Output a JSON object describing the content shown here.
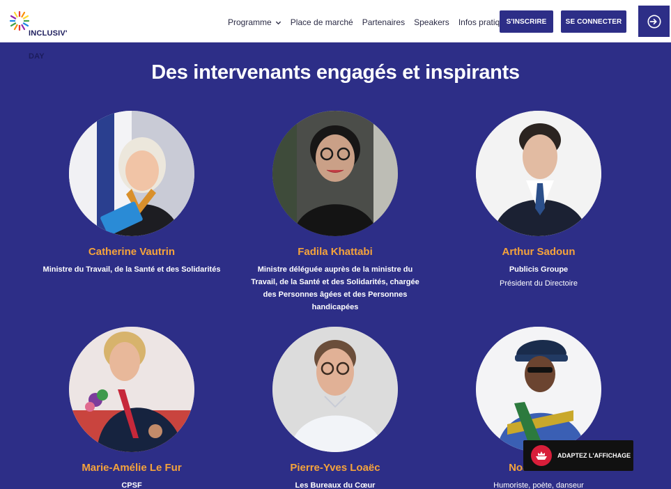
{
  "header": {
    "logo": {
      "line1": "INCLUSIV'",
      "line2": "DAY"
    },
    "nav": [
      {
        "label": "Programme",
        "dropdown": true
      },
      {
        "label": "Place de marché"
      },
      {
        "label": "Partenaires"
      },
      {
        "label": "Speakers"
      },
      {
        "label": "Infos pratiques"
      }
    ],
    "register_label": "S'INSCRIRE",
    "login_label": "SE CONNECTER",
    "exit_icon": "sign-in-icon"
  },
  "section": {
    "title": "Des intervenants engagés et inspirants"
  },
  "speakers": [
    {
      "name": "Catherine Vautrin",
      "org": "Ministre du Travail, de la Santé et des Solidarités",
      "role": ""
    },
    {
      "name": "Fadila Khattabi",
      "org": "Ministre déléguée auprès de la ministre du Travail, de la Santé et des Solidarités, chargée des Personnes âgées et des Personnes handicapées",
      "role": ""
    },
    {
      "name": "Arthur Sadoun",
      "org": "Publicis Groupe",
      "role": "Président du Directoire"
    },
    {
      "name": "Marie-Amélie Le Fur",
      "org": "CPSF",
      "role": ""
    },
    {
      "name": "Pierre-Yves Loaëc",
      "org": "Les Bureaux du Cœur",
      "role": ""
    },
    {
      "name": "Noam Cissé",
      "org": "",
      "role": "Humoriste, poète, danseur"
    }
  ],
  "accessibility_widget": {
    "label": "ADAPTEZ L'AFFICHAGE",
    "icon": "ship-icon"
  },
  "colors": {
    "brand": "#2d2e87",
    "accent": "#f5a33b",
    "widget": "#d81e3a"
  }
}
